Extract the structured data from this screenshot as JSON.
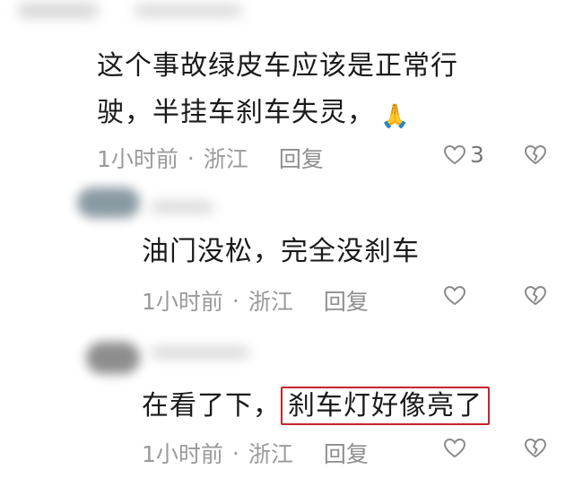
{
  "comments": [
    {
      "text_line1": "这个事故绿皮车应该是正常行",
      "text_line2": "驶，半挂车刹车失灵，",
      "emoji": "🙏",
      "time": "1小时前",
      "location": "浙江",
      "reply": "回复",
      "like_count": "3"
    },
    {
      "text": "油门没松，完全没刹车",
      "time": "1小时前",
      "location": "浙江",
      "reply": "回复",
      "like_count": ""
    },
    {
      "text_prefix": "在看了下，",
      "text_highlight": "刹车灯好像亮了",
      "time": "1小时前",
      "location": "浙江",
      "reply": "回复",
      "like_count": ""
    }
  ],
  "separator": "·",
  "highlight_color": "#c8232c",
  "icons": {
    "like": "heart-outline-icon",
    "dislike": "broken-heart-icon"
  }
}
